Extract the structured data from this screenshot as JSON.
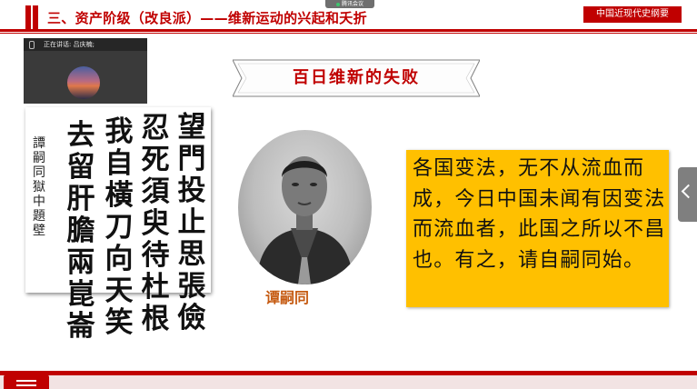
{
  "header": {
    "title": "三、资产阶级（改良派）——维新运动的兴起和夭折",
    "course_label": "中国近现代史纲要"
  },
  "meeting": {
    "badge_label": "腾讯会议",
    "speaker_label": "正在讲话: 吕庆楠;"
  },
  "slide": {
    "banner_title": "百日维新的失败",
    "portrait_name": "谭嗣同",
    "quote": "各国变法，无不从流血而成，今日中国未闻有因变法而流血者，此国之所以不昌也。有之，请自嗣同始。",
    "calligraphy": {
      "columns": [
        "望門投止思張儉",
        "忍死須臾待杜根",
        "我自橫刀向天笑",
        "去留肝膽兩崑崙"
      ],
      "signature": "譚嗣同獄中題壁"
    }
  },
  "colors": {
    "accent": "#c00000",
    "quote_bg": "#ffc000",
    "name_color": "#c55a11"
  }
}
